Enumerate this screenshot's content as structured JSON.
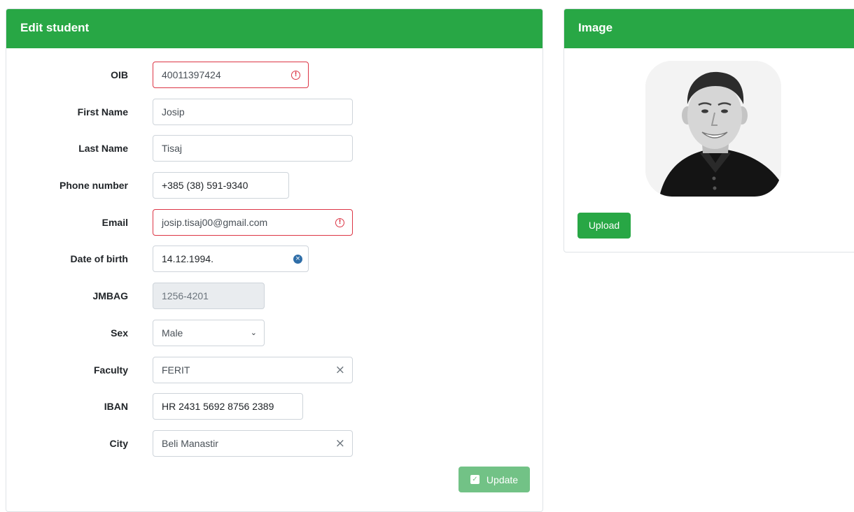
{
  "edit_card": {
    "title": "Edit student",
    "fields": {
      "oib": {
        "label": "OIB",
        "value": "40011397424"
      },
      "first_name": {
        "label": "First Name",
        "value": "Josip"
      },
      "last_name": {
        "label": "Last Name",
        "value": "Tisaj"
      },
      "phone": {
        "label": "Phone number",
        "value": "+385 (38) 591-9340"
      },
      "email": {
        "label": "Email",
        "value": "josip.tisaj00@gmail.com"
      },
      "dob": {
        "label": "Date of birth",
        "value": "14.12.1994."
      },
      "jmbag": {
        "label": "JMBAG",
        "value": "1256-4201"
      },
      "sex": {
        "label": "Sex",
        "value": "Male"
      },
      "faculty": {
        "label": "Faculty",
        "value": "FERIT"
      },
      "iban": {
        "label": "IBAN",
        "value": "HR 2431 5692 8756 2389"
      },
      "city": {
        "label": "City",
        "value": "Beli Manastir"
      }
    },
    "update_label": "Update"
  },
  "image_card": {
    "title": "Image",
    "upload_label": "Upload"
  },
  "icons": {
    "error": "exclamation-circle-icon",
    "clear_date": "clear-date-icon",
    "clear": "x-icon",
    "dropdown": "chevron-down-icon",
    "update": "check-square-icon"
  },
  "colors": {
    "header_green": "#28a745",
    "update_button": "#72c286",
    "invalid_border": "#dc3545",
    "date_clear_blue": "#2f6ea8"
  }
}
